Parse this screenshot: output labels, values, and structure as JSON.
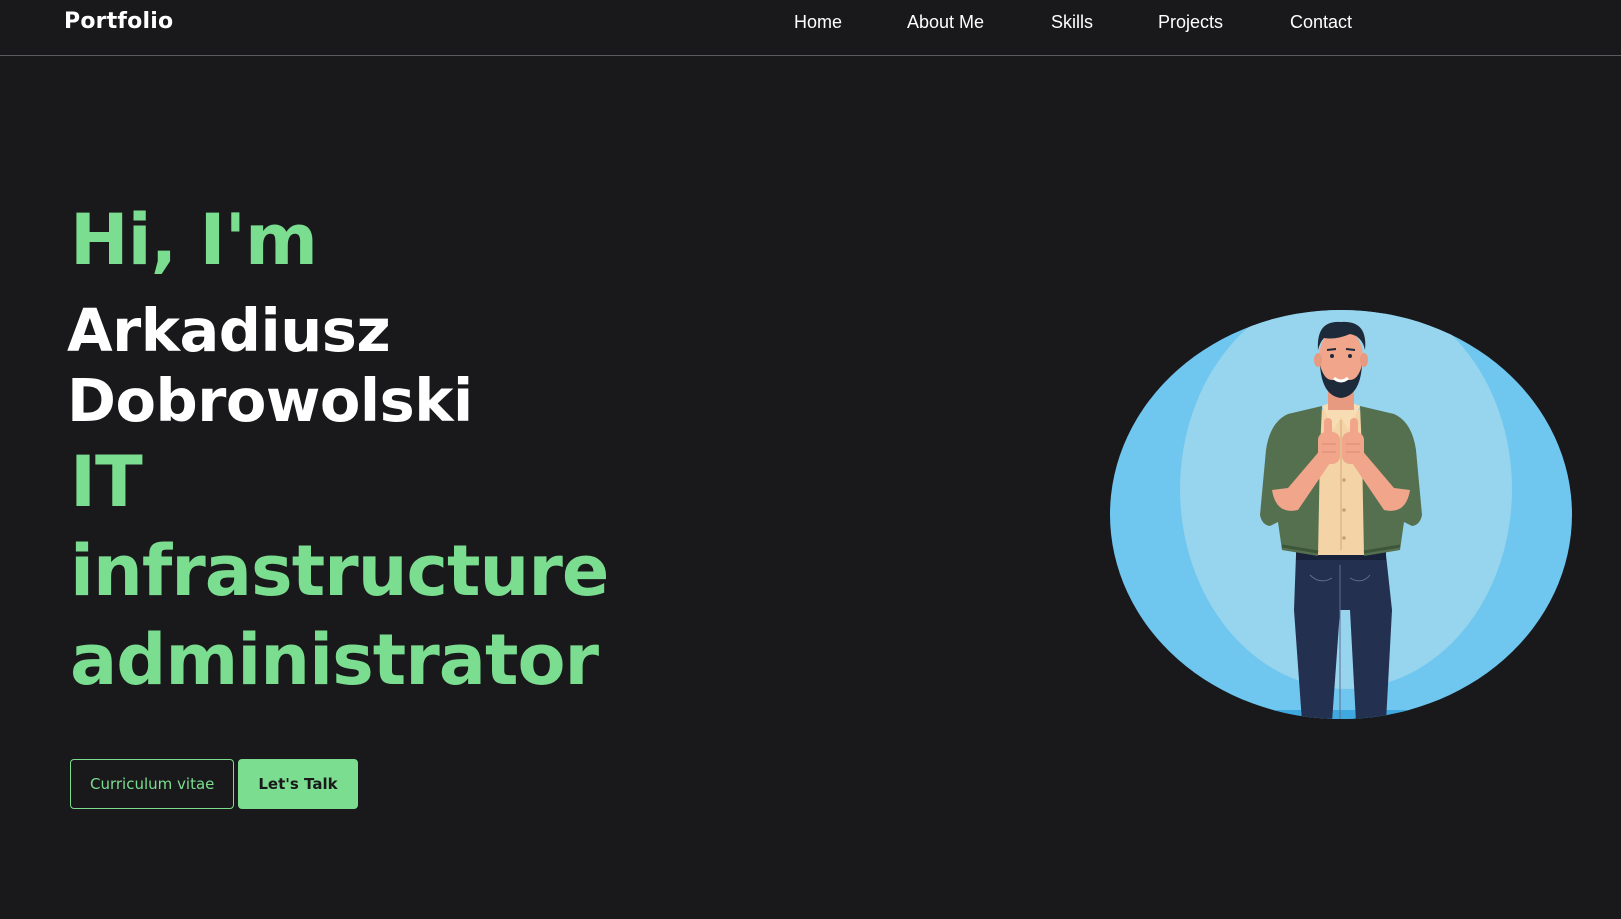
{
  "navbar": {
    "logo": "Portfolio",
    "links": [
      {
        "label": "Home"
      },
      {
        "label": "About Me"
      },
      {
        "label": "Skills"
      },
      {
        "label": "Projects"
      },
      {
        "label": "Contact"
      }
    ]
  },
  "hero": {
    "greeting": "Hi, I'm",
    "name_first": "Arkadiusz",
    "name_last": "Dobrowolski",
    "role_lines": [
      "IT",
      "infrastructure",
      "administrator"
    ],
    "cv_button": "Curriculum vitae",
    "talk_button": "Let's Talk"
  },
  "colors": {
    "background": "#19191c",
    "accent": "#7bdd90",
    "text": "#ffffff",
    "circle_outer": "#6fc6ef",
    "circle_inner": "#97d4ee"
  },
  "icons": {
    "avatar": "man-thumbs-up-illustration"
  }
}
